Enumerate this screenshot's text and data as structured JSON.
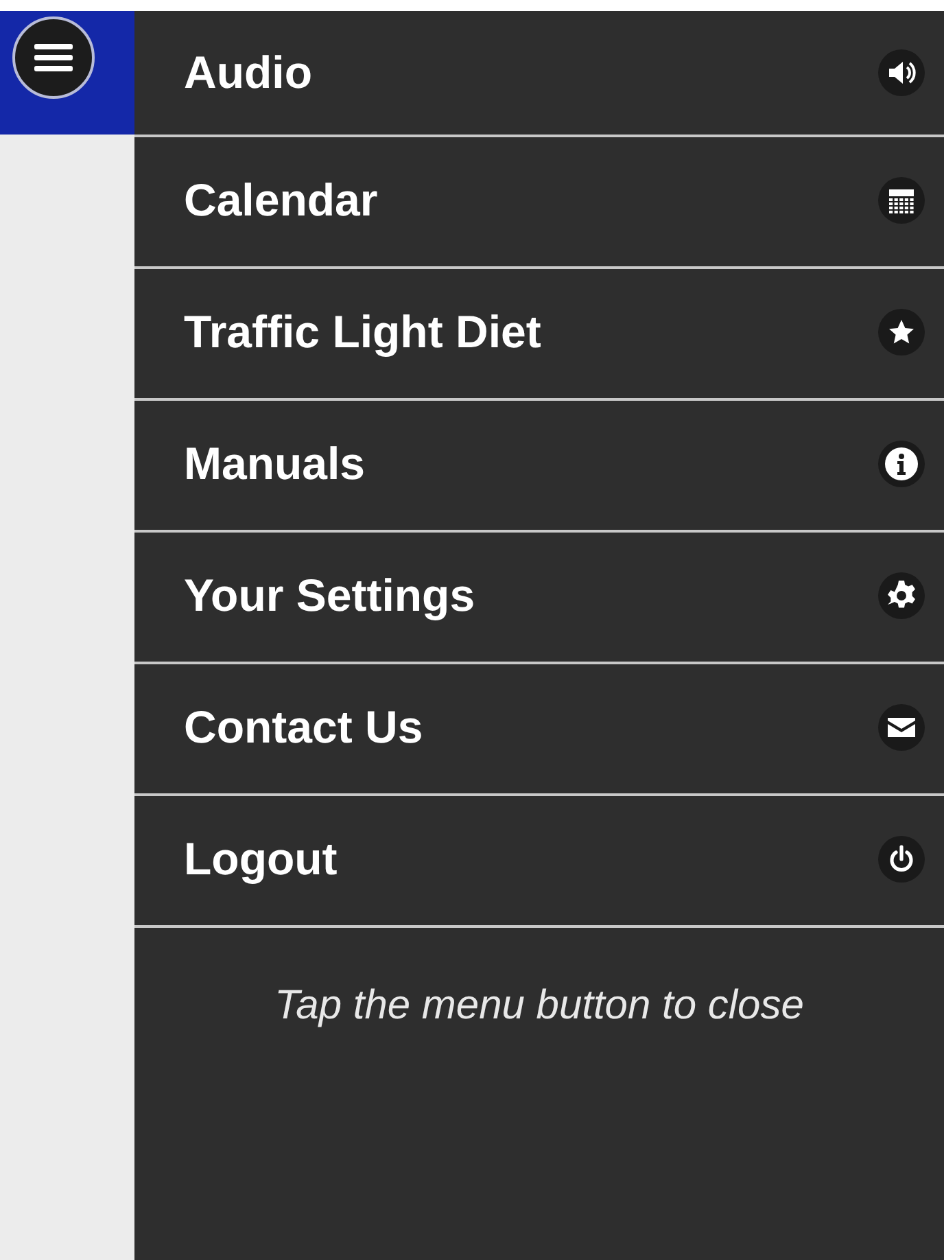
{
  "menu_items": [
    {
      "label": "Audio"
    },
    {
      "label": "Calendar"
    },
    {
      "label": "Traffic Light Diet"
    },
    {
      "label": "Manuals"
    },
    {
      "label": "Your Settings"
    },
    {
      "label": "Contact Us"
    },
    {
      "label": "Logout"
    }
  ],
  "footer_hint": "Tap the menu button to close"
}
